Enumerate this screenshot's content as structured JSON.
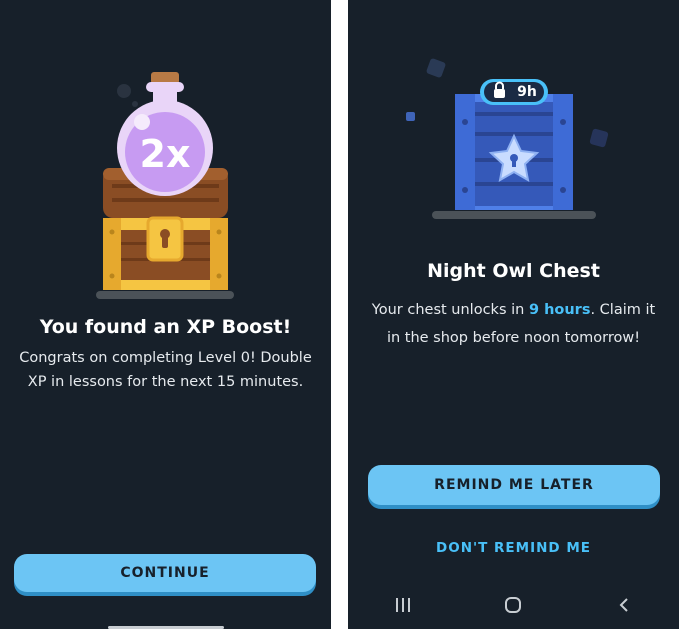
{
  "left_screen": {
    "boost_label": "2x",
    "title": "You found an XP Boost!",
    "body_line1": "Congrats on completing Level 0! Double",
    "body_line2": "XP in lessons for the next 15 minutes.",
    "continue_label": "CONTINUE",
    "icons": [
      "potion-icon",
      "treasure-chest-icon",
      "keyhole-icon"
    ]
  },
  "right_screen": {
    "timer_label": "9h",
    "title": "Night Owl Chest",
    "body_prefix": "Your chest unlocks in ",
    "body_highlight": "9 hours",
    "body_suffix": ". Claim it",
    "body_line2": "in the shop before noon tomorrow!",
    "remind_label": "REMIND ME LATER",
    "dont_remind_label": "DON'T REMIND ME",
    "icons": [
      "lock-icon",
      "night-owl-chest-icon",
      "star-icon",
      "recent-apps-icon",
      "home-icon",
      "back-icon"
    ]
  },
  "colors": {
    "background": "#17202a",
    "accent": "#49c0f8",
    "button": "#6cc5f4",
    "potion": "#c79bf2",
    "chest_blue": "#5b8cf0",
    "chest_gold": "#f5c542"
  }
}
